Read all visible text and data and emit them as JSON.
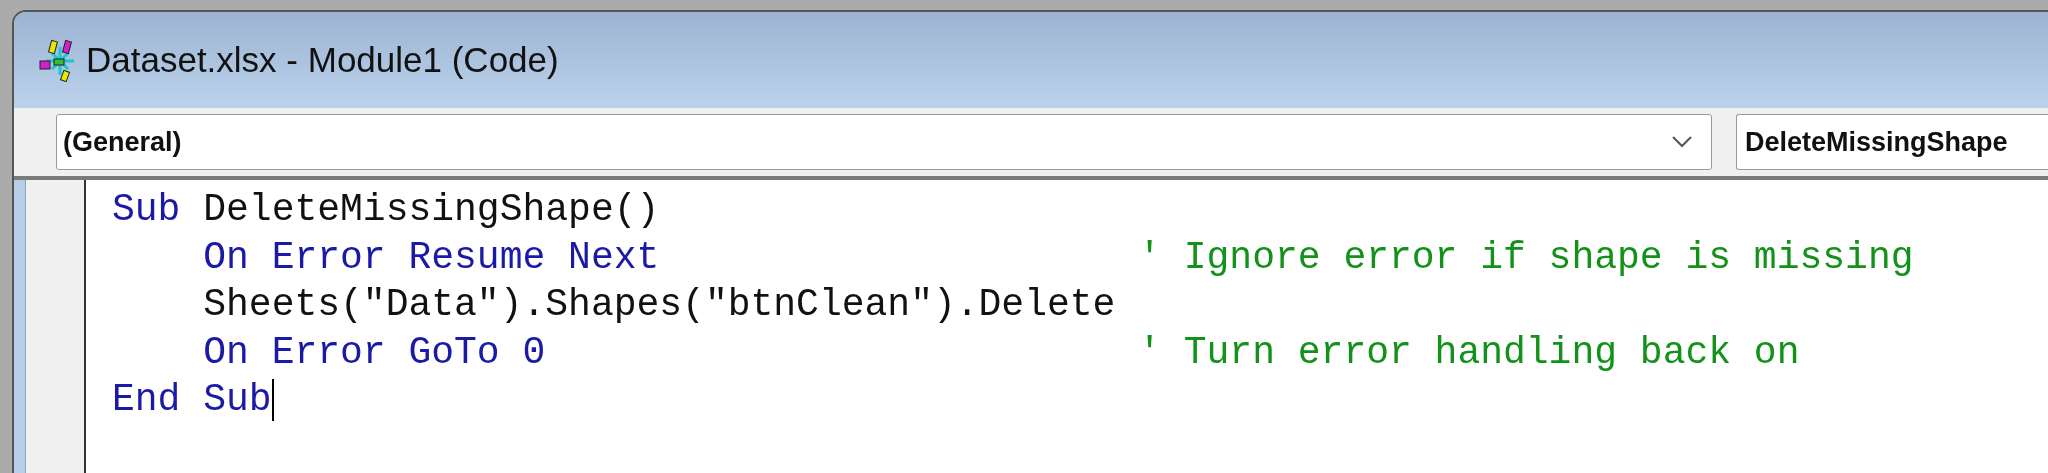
{
  "window": {
    "title": "Dataset.xlsx - Module1 (Code)"
  },
  "object_box": {
    "value": "(General)"
  },
  "procedure_box": {
    "value": "DeleteMissingShape"
  },
  "code": {
    "lines": [
      {
        "tokens": [
          {
            "kind": "keyword",
            "text": "Sub"
          },
          {
            "kind": "plain",
            "text": " DeleteMissingShape()"
          }
        ]
      },
      {
        "tokens": [
          {
            "kind": "keyword",
            "text": "    On Error Resume Next"
          }
        ],
        "comment": "' Ignore error if shape is missing"
      },
      {
        "tokens": [
          {
            "kind": "plain",
            "text": "    Sheets(\"Data\").Shapes(\"btnClean\").Delete"
          }
        ]
      },
      {
        "tokens": [
          {
            "kind": "keyword",
            "text": "    On Error GoTo 0"
          }
        ],
        "comment": "' Turn error handling back on"
      },
      {
        "tokens": [
          {
            "kind": "keyword",
            "text": "End Sub"
          }
        ],
        "cursor": true
      }
    ]
  }
}
